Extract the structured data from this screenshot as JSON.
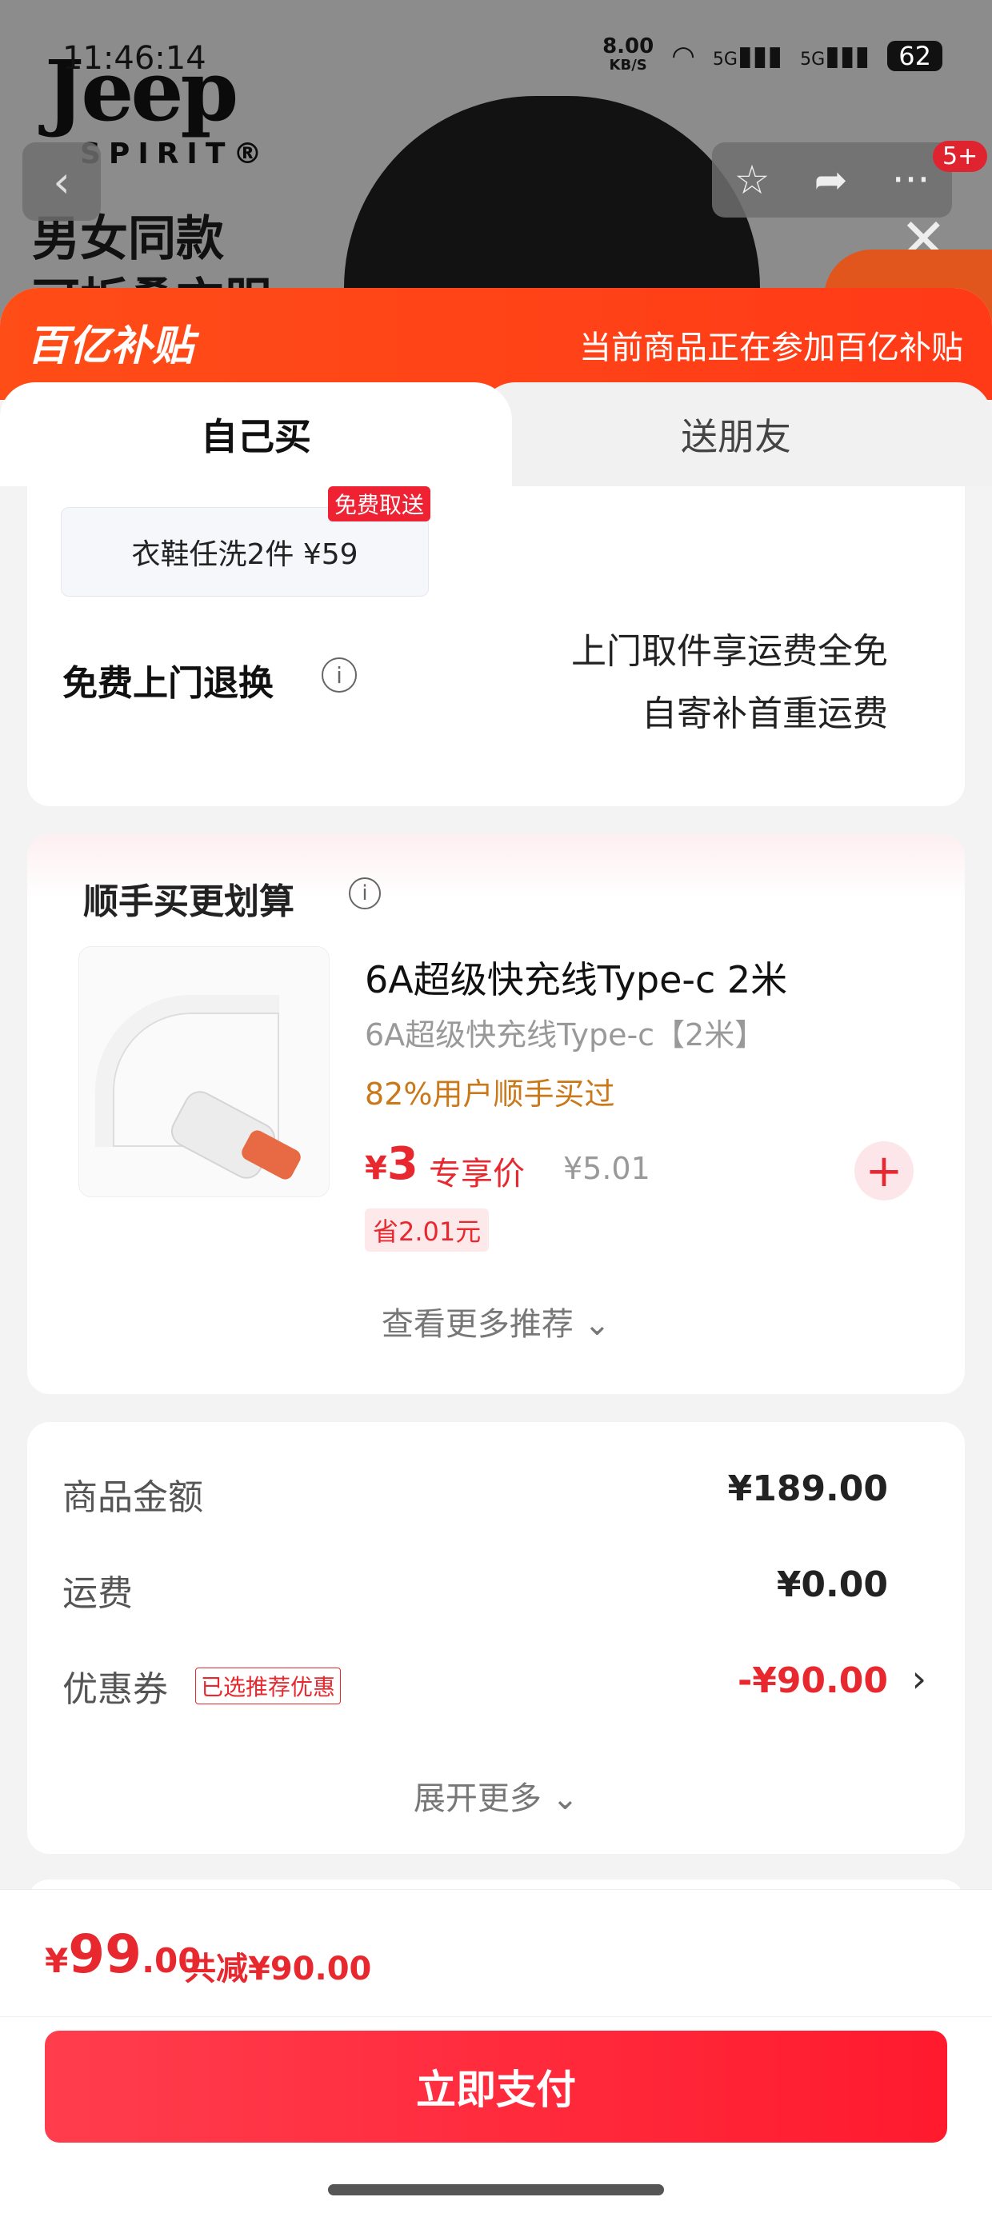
{
  "status_bar": {
    "time": "11:46:14",
    "net_speed": "8.00",
    "net_unit": "KB/S",
    "signal_1": "5G",
    "signal_2": "5G",
    "battery": "62"
  },
  "background": {
    "brand": "Jeep",
    "brand_sub": "SPIRIT®",
    "headline_1": "男女同款",
    "headline_2": "可折叠衣服",
    "share_badge": "5+"
  },
  "subsidy": {
    "logo": "百亿补贴",
    "note": "当前商品正在参加百亿补贴"
  },
  "tabs": [
    {
      "label": "自己买"
    },
    {
      "label": "送朋友"
    }
  ],
  "service": {
    "chip_text": "衣鞋任洗2件 ¥59",
    "chip_tag": "免费取送",
    "return_label": "免费上门退换",
    "return_line1": "上门取件享运费全免",
    "return_line2": "自寄补首重运费"
  },
  "addon": {
    "section_title": "顺手买更划算",
    "product_title": "6A超级快充线Type-c 2米",
    "product_sub": "6A超级快充线Type-c【2米】",
    "product_stat": "82%用户顺手买过",
    "price_symbol": "¥",
    "price": "3",
    "price_label": "专享价",
    "old_price": "¥5.01",
    "save_text": "省2.01元",
    "more_label": "查看更多推荐 ⌄"
  },
  "summary": {
    "rows": [
      {
        "label": "商品金额",
        "value": "¥189.00"
      },
      {
        "label": "运费",
        "value": "¥0.00"
      }
    ],
    "coupon_label": "优惠券",
    "coupon_tag": "已选推荐优惠",
    "coupon_value": "-¥90.00",
    "more_label": "展开更多 ⌄"
  },
  "footer": {
    "currency": "¥",
    "total_int": "99",
    "total_dec": ".00",
    "saving": "共减¥90.00",
    "pay_label": "立即支付"
  },
  "colors": {
    "accent_red": "#e8282f",
    "subsidy_orange": "#ff4d17",
    "pay_button": "#ff2a3a"
  }
}
